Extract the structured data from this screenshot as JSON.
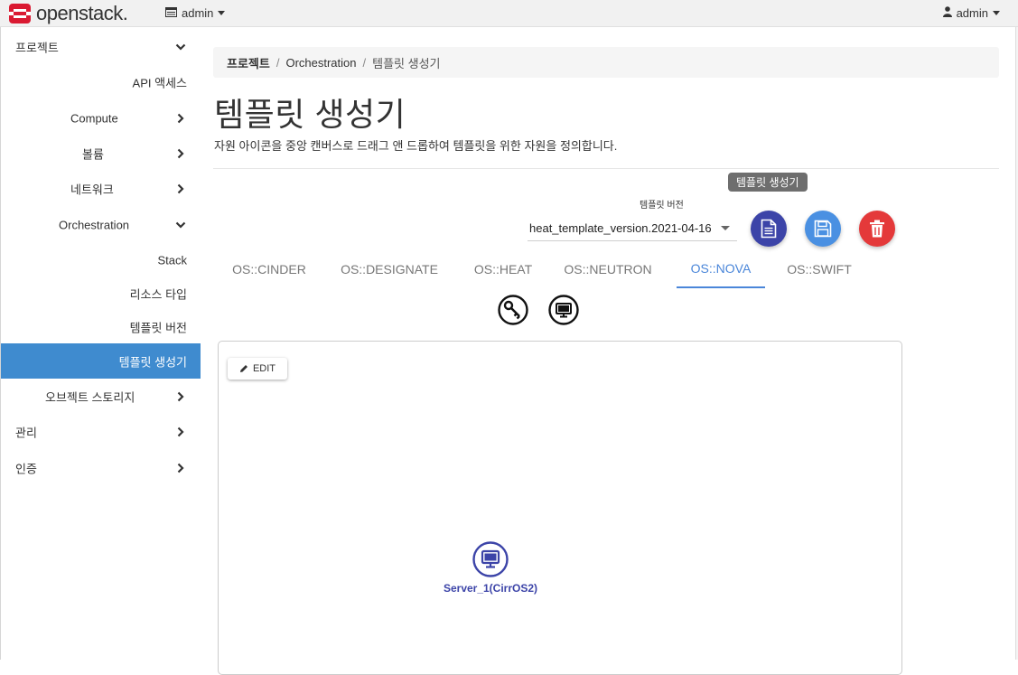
{
  "navbar": {
    "brand": "openstack.",
    "project": "admin",
    "user": "admin"
  },
  "sidebar": {
    "items": [
      {
        "label": "프로젝트"
      },
      {
        "label": "API 액세스"
      },
      {
        "label": "Compute"
      },
      {
        "label": "볼륨"
      },
      {
        "label": "네트워크"
      },
      {
        "label": "Orchestration"
      },
      {
        "label": "Stack"
      },
      {
        "label": "리소스 타입"
      },
      {
        "label": "템플릿 버전"
      },
      {
        "label": "템플릿 생성기"
      },
      {
        "label": "오브젝트 스토리지"
      },
      {
        "label": "관리"
      },
      {
        "label": "인증"
      }
    ]
  },
  "breadcrumb": {
    "items": [
      "프로젝트",
      "Orchestration",
      "템플릿 생성기"
    ],
    "separator": "/"
  },
  "page": {
    "title": "템플릿 생성기",
    "description": "자원 아이콘을 중앙 캔버스로 드래그 앤 드롭하여 템플릿을 위한 자원을 정의합니다."
  },
  "toolbar": {
    "tooltip": "템플릿 생성기",
    "version_label": "템플릿 버전",
    "version_value": "heat_template_version.2021-04-16"
  },
  "tabs": [
    "OS::CINDER",
    "OS::DESIGNATE",
    "OS::HEAT",
    "OS::NEUTRON",
    "OS::NOVA",
    "OS::SWIFT"
  ],
  "active_tab": "OS::NOVA",
  "resource_icons": [
    "key-icon",
    "server-icon"
  ],
  "canvas": {
    "edit_label": "EDIT",
    "node_label": "Server_1(CirrOS2)"
  },
  "colors": {
    "accent": "#3f8bcf",
    "tab_active": "#4a86d9",
    "generate": "#3c44a8",
    "save": "#4a90e2",
    "delete": "#e4393a",
    "brand_red": "#da1a32"
  }
}
